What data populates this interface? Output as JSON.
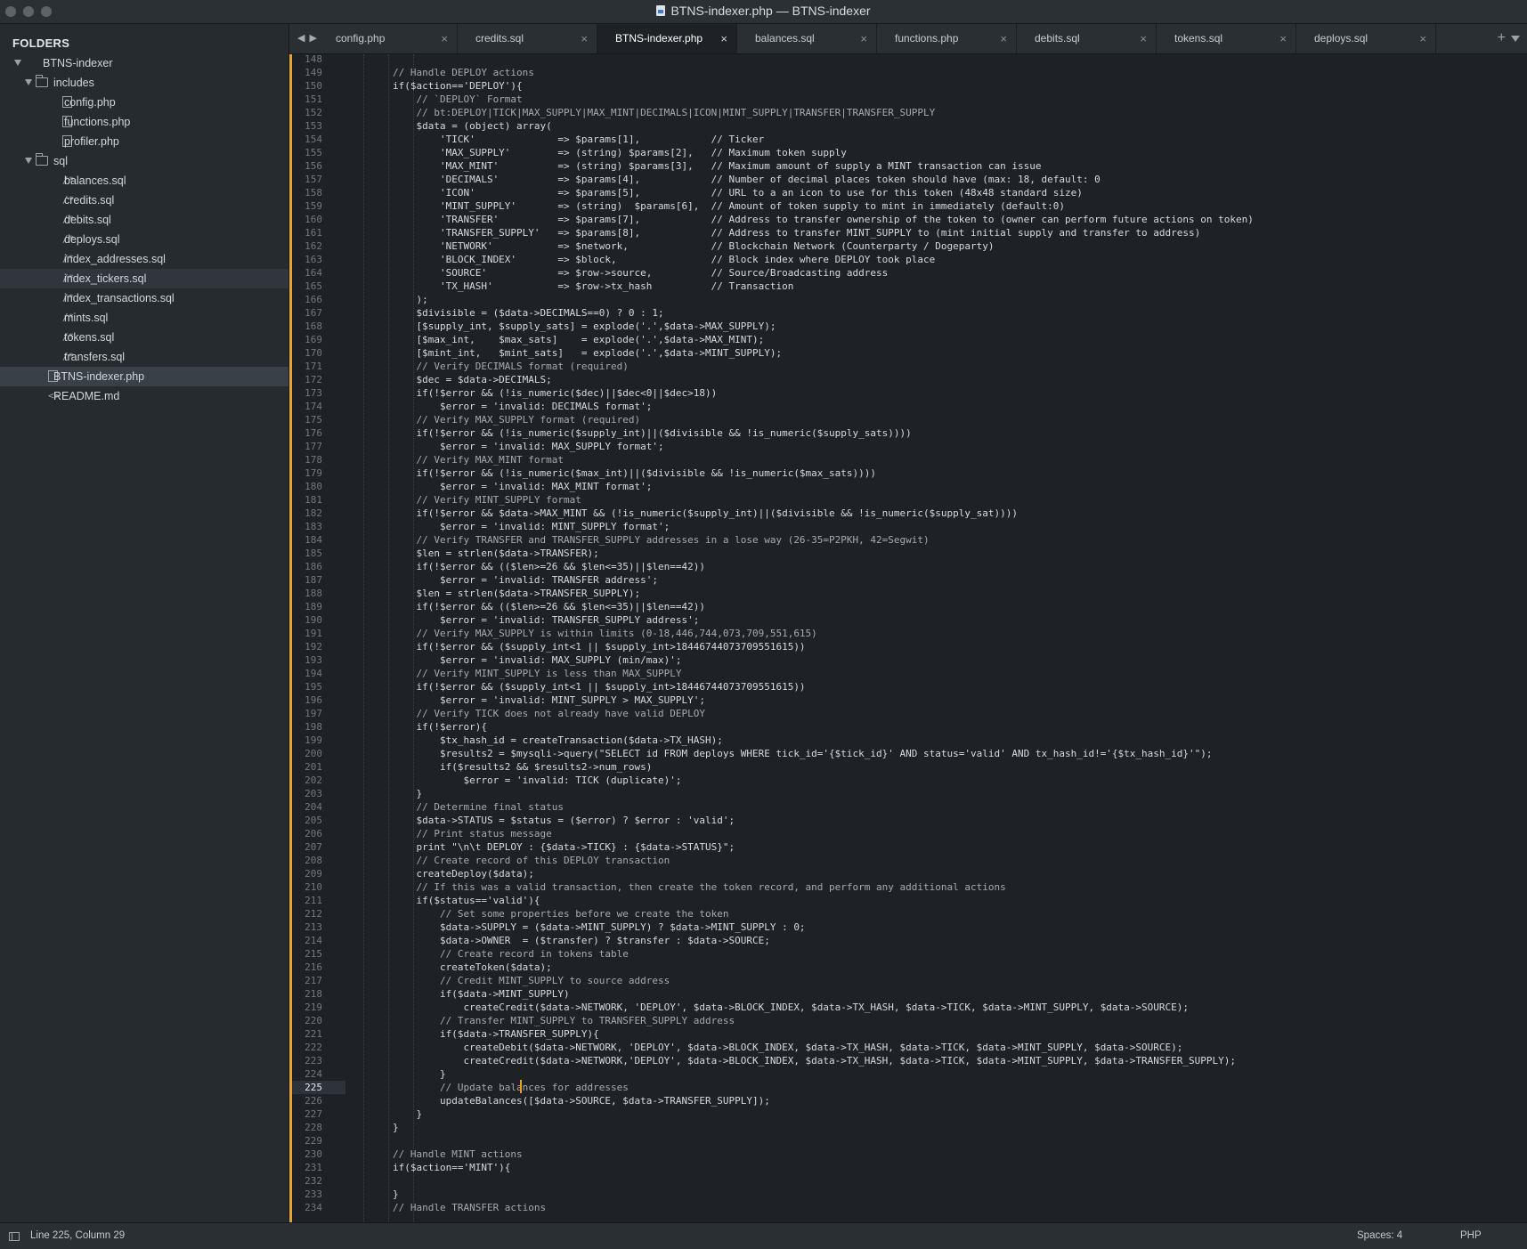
{
  "window": {
    "title": "BTNS-indexer.php — BTNS-indexer"
  },
  "sidebar": {
    "header": "FOLDERS",
    "tree": [
      {
        "label": "BTNS-indexer",
        "type": "folder",
        "level": 0,
        "expanded": true
      },
      {
        "label": "includes",
        "type": "folder",
        "level": 1,
        "expanded": true
      },
      {
        "label": "config.php",
        "type": "file",
        "level": 2
      },
      {
        "label": "functions.php",
        "type": "file",
        "level": 2
      },
      {
        "label": "profiler.php",
        "type": "file",
        "level": 2
      },
      {
        "label": "sql",
        "type": "folder",
        "level": 1,
        "expanded": true
      },
      {
        "label": "balances.sql",
        "type": "sql",
        "level": 2
      },
      {
        "label": "credits.sql",
        "type": "sql",
        "level": 2
      },
      {
        "label": "debits.sql",
        "type": "sql",
        "level": 2
      },
      {
        "label": "deploys.sql",
        "type": "sql",
        "level": 2
      },
      {
        "label": "index_addresses.sql",
        "type": "sql",
        "level": 2
      },
      {
        "label": "index_tickers.sql",
        "type": "sql",
        "level": 2,
        "hover": true
      },
      {
        "label": "index_transactions.sql",
        "type": "sql",
        "level": 2
      },
      {
        "label": "mints.sql",
        "type": "sql",
        "level": 2
      },
      {
        "label": "tokens.sql",
        "type": "sql",
        "level": 2
      },
      {
        "label": "transfers.sql",
        "type": "sql",
        "level": 2
      },
      {
        "label": "BTNS-indexer.php",
        "type": "file",
        "level": 1,
        "selected": true
      },
      {
        "label": "README.md",
        "type": "md",
        "level": 1
      }
    ]
  },
  "tabs": [
    {
      "label": "config.php",
      "active": false
    },
    {
      "label": "credits.sql",
      "active": false
    },
    {
      "label": "BTNS-indexer.php",
      "active": true
    },
    {
      "label": "balances.sql",
      "active": false
    },
    {
      "label": "functions.php",
      "active": false
    },
    {
      "label": "debits.sql",
      "active": false
    },
    {
      "label": "tokens.sql",
      "active": false
    },
    {
      "label": "deploys.sql",
      "active": false
    }
  ],
  "tab_close_glyph": "×",
  "tab_add_glyph": "+",
  "nav_arrows": "◀▶",
  "editor": {
    "first_line_number": 148,
    "current_line": 225,
    "lines": [
      "",
      "        // Handle DEPLOY actions",
      "        if($action=='DEPLOY'){",
      "            // `DEPLOY` Format",
      "            // bt:DEPLOY|TICK|MAX_SUPPLY|MAX_MINT|DECIMALS|ICON|MINT_SUPPLY|TRANSFER|TRANSFER_SUPPLY",
      "            $data = (object) array(",
      "                'TICK'              => $params[1],            // Ticker",
      "                'MAX_SUPPLY'        => (string) $params[2],   // Maximum token supply",
      "                'MAX_MINT'          => (string) $params[3],   // Maximum amount of supply a MINT transaction can issue",
      "                'DECIMALS'          => $params[4],            // Number of decimal places token should have (max: 18, default: 0",
      "                'ICON'              => $params[5],            // URL to a an icon to use for this token (48x48 standard size)",
      "                'MINT_SUPPLY'       => (string)  $params[6],  // Amount of token supply to mint in immediately (default:0)",
      "                'TRANSFER'          => $params[7],            // Address to transfer ownership of the token to (owner can perform future actions on token)",
      "                'TRANSFER_SUPPLY'   => $params[8],            // Address to transfer MINT_SUPPLY to (mint initial supply and transfer to address)",
      "                'NETWORK'           => $network,              // Blockchain Network (Counterparty / Dogeparty)",
      "                'BLOCK_INDEX'       => $block,                // Block index where DEPLOY took place",
      "                'SOURCE'            => $row->source,          // Source/Broadcasting address",
      "                'TX_HASH'           => $row->tx_hash          // Transaction",
      "            );",
      "            $divisible = ($data->DECIMALS==0) ? 0 : 1;",
      "            [$supply_int, $supply_sats] = explode('.',$data->MAX_SUPPLY);",
      "            [$max_int,    $max_sats]    = explode('.',$data->MAX_MINT);",
      "            [$mint_int,   $mint_sats]   = explode('.',$data->MINT_SUPPLY);",
      "            // Verify DECIMALS format (required)",
      "            $dec = $data->DECIMALS;",
      "            if(!$error && (!is_numeric($dec)||$dec<0||$dec>18))",
      "                $error = 'invalid: DECIMALS format';",
      "            // Verify MAX_SUPPLY format (required)",
      "            if(!$error && (!is_numeric($supply_int)||($divisible && !is_numeric($supply_sats))))",
      "                $error = 'invalid: MAX_SUPPLY format';",
      "            // Verify MAX_MINT format",
      "            if(!$error && (!is_numeric($max_int)||($divisible && !is_numeric($max_sats))))",
      "                $error = 'invalid: MAX_MINT format';",
      "            // Verify MINT_SUPPLY format",
      "            if(!$error && $data->MAX_MINT && (!is_numeric($supply_int)||($divisible && !is_numeric($supply_sat))))",
      "                $error = 'invalid: MINT_SUPPLY format';",
      "            // Verify TRANSFER and TRANSFER_SUPPLY addresses in a lose way (26-35=P2PKH, 42=Segwit)",
      "            $len = strlen($data->TRANSFER);",
      "            if(!$error && (($len>=26 && $len<=35)||$len==42))",
      "                $error = 'invalid: TRANSFER address';",
      "            $len = strlen($data->TRANSFER_SUPPLY);",
      "            if(!$error && (($len>=26 && $len<=35)||$len==42))",
      "                $error = 'invalid: TRANSFER_SUPPLY address';",
      "            // Verify MAX_SUPPLY is within limits (0-18,446,744,073,709,551,615)",
      "            if(!$error && ($supply_int<1 || $supply_int>18446744073709551615))",
      "                $error = 'invalid: MAX_SUPPLY (min/max)';",
      "            // Verify MINT_SUPPLY is less than MAX_SUPPLY",
      "            if(!$error && ($supply_int<1 || $supply_int>18446744073709551615))",
      "                $error = 'invalid: MINT_SUPPLY > MAX_SUPPLY';",
      "            // Verify TICK does not already have valid DEPLOY",
      "            if(!$error){",
      "                $tx_hash_id = createTransaction($data->TX_HASH);",
      "                $results2 = $mysqli->query(\"SELECT id FROM deploys WHERE tick_id='{$tick_id}' AND status='valid' AND tx_hash_id!='{$tx_hash_id}'\");",
      "                if($results2 && $results2->num_rows)",
      "                    $error = 'invalid: TICK (duplicate)';",
      "            }",
      "            // Determine final status",
      "            $data->STATUS = $status = ($error) ? $error : 'valid';",
      "            // Print status message",
      "            print \"\\n\\t DEPLOY : {$data->TICK} : {$data->STATUS}\";",
      "            // Create record of this DEPLOY transaction",
      "            createDeploy($data);",
      "            // If this was a valid transaction, then create the token record, and perform any additional actions",
      "            if($status=='valid'){",
      "                // Set some properties before we create the token",
      "                $data->SUPPLY = ($data->MINT_SUPPLY) ? $data->MINT_SUPPLY : 0;",
      "                $data->OWNER  = ($transfer) ? $transfer : $data->SOURCE;",
      "                // Create record in tokens table",
      "                createToken($data);",
      "                // Credit MINT_SUPPLY to source address",
      "                if($data->MINT_SUPPLY)",
      "                    createCredit($data->NETWORK, 'DEPLOY', $data->BLOCK_INDEX, $data->TX_HASH, $data->TICK, $data->MINT_SUPPLY, $data->SOURCE);",
      "                // Transfer MINT_SUPPLY to TRANSFER_SUPPLY address",
      "                if($data->TRANSFER_SUPPLY){",
      "                    createDebit($data->NETWORK, 'DEPLOY', $data->BLOCK_INDEX, $data->TX_HASH, $data->TICK, $data->MINT_SUPPLY, $data->SOURCE);",
      "                    createCredit($data->NETWORK,'DEPLOY', $data->BLOCK_INDEX, $data->TX_HASH, $data->TICK, $data->MINT_SUPPLY, $data->TRANSFER_SUPPLY);",
      "                }",
      "                // Update balances for addresses",
      "                updateBalances([$data->SOURCE, $data->TRANSFER_SUPPLY]);",
      "            }",
      "        }",
      "",
      "        // Handle MINT actions",
      "        if($action=='MINT'){",
      "",
      "        }",
      "        // Handle TRANSFER actions"
    ]
  },
  "statusbar": {
    "position": "Line 225, Column 29",
    "indentation": "Spaces: 4",
    "syntax": "PHP"
  }
}
